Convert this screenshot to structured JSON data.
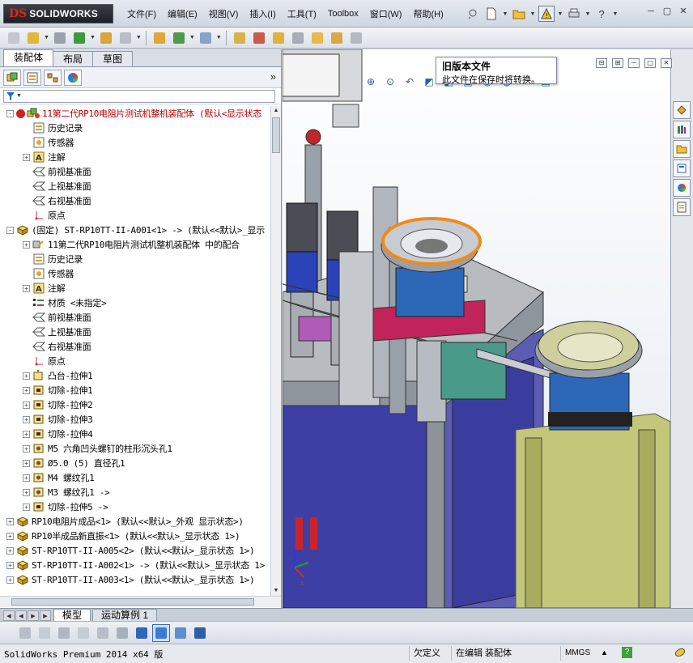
{
  "app": {
    "logo_ds": "DS",
    "logo_name": "SOLIDWORKS"
  },
  "menu": [
    "文件(F)",
    "编辑(E)",
    "视图(V)",
    "插入(I)",
    "工具(T)",
    "Toolbox",
    "窗口(W)",
    "帮助(H)"
  ],
  "panel_tabs": [
    "装配体",
    "布局",
    "草图"
  ],
  "tree": [
    {
      "indent": 0,
      "exp": "-",
      "icon": "assembly-icon",
      "label": "11第二代RP10电阻片测试机整机装配体  (默认<显示状态",
      "red": true
    },
    {
      "indent": 1,
      "exp": "",
      "icon": "history-icon",
      "label": "历史记录"
    },
    {
      "indent": 1,
      "exp": "",
      "icon": "sensor-icon",
      "label": "传感器"
    },
    {
      "indent": 1,
      "exp": "+",
      "icon": "annotation-icon",
      "label": "注解"
    },
    {
      "indent": 1,
      "exp": "",
      "icon": "plane-icon",
      "label": "前视基准面"
    },
    {
      "indent": 1,
      "exp": "",
      "icon": "plane-icon",
      "label": "上视基准面"
    },
    {
      "indent": 1,
      "exp": "",
      "icon": "plane-icon",
      "label": "右视基准面"
    },
    {
      "indent": 1,
      "exp": "",
      "icon": "origin-icon",
      "label": "原点"
    },
    {
      "indent": 0,
      "exp": "-",
      "icon": "part-icon",
      "label": "(固定) ST-RP10TT-II-A001<1> -> (默认<<默认>_显示"
    },
    {
      "indent": 1,
      "exp": "+",
      "icon": "mate-icon",
      "label": "11第二代RP10电阻片测试机整机装配体 中的配合"
    },
    {
      "indent": 1,
      "exp": "",
      "icon": "history-icon",
      "label": "历史记录"
    },
    {
      "indent": 1,
      "exp": "",
      "icon": "sensor-icon",
      "label": "传感器"
    },
    {
      "indent": 1,
      "exp": "+",
      "icon": "annotation-icon",
      "label": "注解"
    },
    {
      "indent": 1,
      "exp": "",
      "icon": "material-icon",
      "label": "材质 <未指定>"
    },
    {
      "indent": 1,
      "exp": "",
      "icon": "plane-icon",
      "label": "前视基准面"
    },
    {
      "indent": 1,
      "exp": "",
      "icon": "plane-icon",
      "label": "上视基准面"
    },
    {
      "indent": 1,
      "exp": "",
      "icon": "plane-icon",
      "label": "右视基准面"
    },
    {
      "indent": 1,
      "exp": "",
      "icon": "origin-icon",
      "label": "原点"
    },
    {
      "indent": 1,
      "exp": "+",
      "icon": "boss-extrude-icon",
      "label": "凸台-拉伸1"
    },
    {
      "indent": 1,
      "exp": "+",
      "icon": "cut-extrude-icon",
      "label": "切除-拉伸1"
    },
    {
      "indent": 1,
      "exp": "+",
      "icon": "cut-extrude-icon",
      "label": "切除-拉伸2"
    },
    {
      "indent": 1,
      "exp": "+",
      "icon": "cut-extrude-icon",
      "label": "切除-拉伸3"
    },
    {
      "indent": 1,
      "exp": "+",
      "icon": "cut-extrude-icon",
      "label": "切除-拉伸4"
    },
    {
      "indent": 1,
      "exp": "+",
      "icon": "hole-icon",
      "label": "M5 六角凹头螺钉的柱形沉头孔1"
    },
    {
      "indent": 1,
      "exp": "+",
      "icon": "hole-icon",
      "label": "Ø5.0 (5) 直径孔1"
    },
    {
      "indent": 1,
      "exp": "+",
      "icon": "hole-icon",
      "label": "M4 螺纹孔1"
    },
    {
      "indent": 1,
      "exp": "+",
      "icon": "hole-icon",
      "label": "M3 螺纹孔1 ->"
    },
    {
      "indent": 1,
      "exp": "+",
      "icon": "cut-extrude-icon",
      "label": "切除-拉伸5 ->"
    },
    {
      "indent": 0,
      "exp": "+",
      "icon": "part-icon",
      "label": "RP10电阻片成品<1> (默认<<默认>_外观 显示状态>)"
    },
    {
      "indent": 0,
      "exp": "+",
      "icon": "part-icon",
      "label": "RP10半成品新直振<1> (默认<<默认>_显示状态 1>)"
    },
    {
      "indent": 0,
      "exp": "+",
      "icon": "part-icon",
      "label": "ST-RP10TT-II-A005<2> (默认<<默认>_显示状态 1>)"
    },
    {
      "indent": 0,
      "exp": "+",
      "icon": "part-icon",
      "label": "ST-RP10TT-II-A002<1> -> (默认<<默认>_显示状态 1>"
    },
    {
      "indent": 0,
      "exp": "+",
      "icon": "part-icon",
      "label": "ST-RP10TT-II-A003<1> (默认<<默认>_显示状态 1>)"
    }
  ],
  "tooltip": {
    "title": "旧版本文件",
    "body": "此文件在保存时将转换。"
  },
  "bottom_tabs": [
    "模型",
    "运动算例 1"
  ],
  "status": {
    "product": "SolidWorks Premium 2014 x64 版",
    "state1": "欠定义",
    "state2": "在编辑 装配体",
    "units": "MMGS",
    "help": "?"
  },
  "colors": {
    "accent_red": "#b00000",
    "select_blue": "#3b6bb5"
  }
}
